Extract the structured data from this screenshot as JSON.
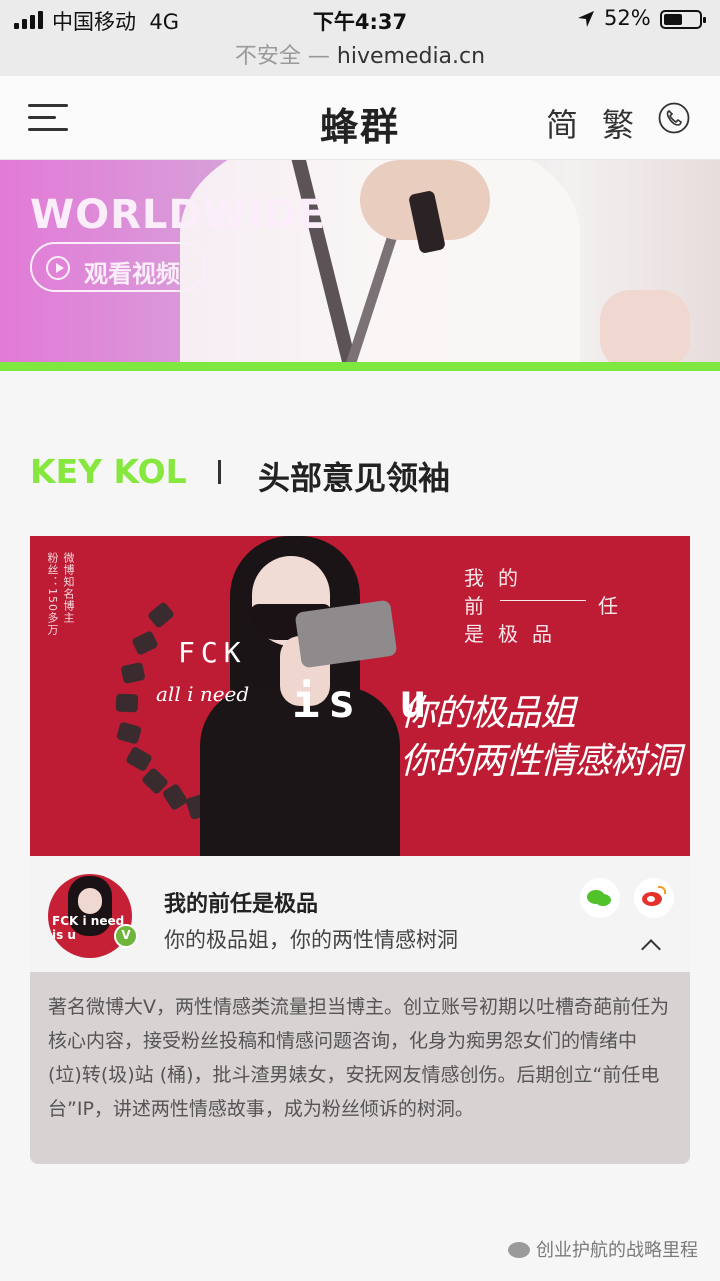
{
  "status_bar": {
    "carrier": "中国移动",
    "network": "4G",
    "time": "下午4:37",
    "battery": "52%",
    "battery_level": 0.52
  },
  "url_bar": {
    "security": "不安全 —",
    "host": "hivemedia.cn"
  },
  "navbar": {
    "logo": "蜂群",
    "lang_simplified": "简",
    "lang_traditional": "繁",
    "icons": [
      "menu-icon",
      "phone-icon"
    ]
  },
  "hero": {
    "headline": "WORLDWIDE",
    "watch_label": "观看视频"
  },
  "section": {
    "title_en": "KEY KOL",
    "title_cn": "头部意见领袖"
  },
  "kol_card": {
    "banner": {
      "vertical_1": "微博知名博主",
      "vertical_2": "粉丝：150多万",
      "fck": "FCK",
      "all_i_need": "all i need",
      "is_u": "is u",
      "poem_line1": "我的",
      "poem_line2_a": "前",
      "poem_line2_b": "任",
      "poem_line3": "是极品",
      "slogan_1": "你的极品姐",
      "slogan_2": "你的两性情感树洞",
      "colors": {
        "background": "#bd1c34"
      }
    },
    "profile": {
      "avatar_text": "FCK i need is u",
      "verified_mark": "V",
      "name": "我的前任是极品",
      "description": "你的极品姐，你的两性情感树洞",
      "social_icons": [
        "wechat-icon",
        "weibo-icon"
      ]
    },
    "bio": "著名微博大V，两性情感类流量担当博主。创立账号初期以吐槽奇葩前任为核心内容，接受粉丝投稿和情感问题咨询，化身为痴男怨女们的情绪中(垃)转(圾)站 (桶)，批斗渣男婊女，安抚网友情感创伤。后期创立“前任电台”IP，讲述两性情感故事，成为粉丝倾诉的树洞。"
  },
  "watermark": "创业护航的战略里程",
  "colors": {
    "accent_green": "#86e83f",
    "banner_red": "#bd1c34"
  }
}
